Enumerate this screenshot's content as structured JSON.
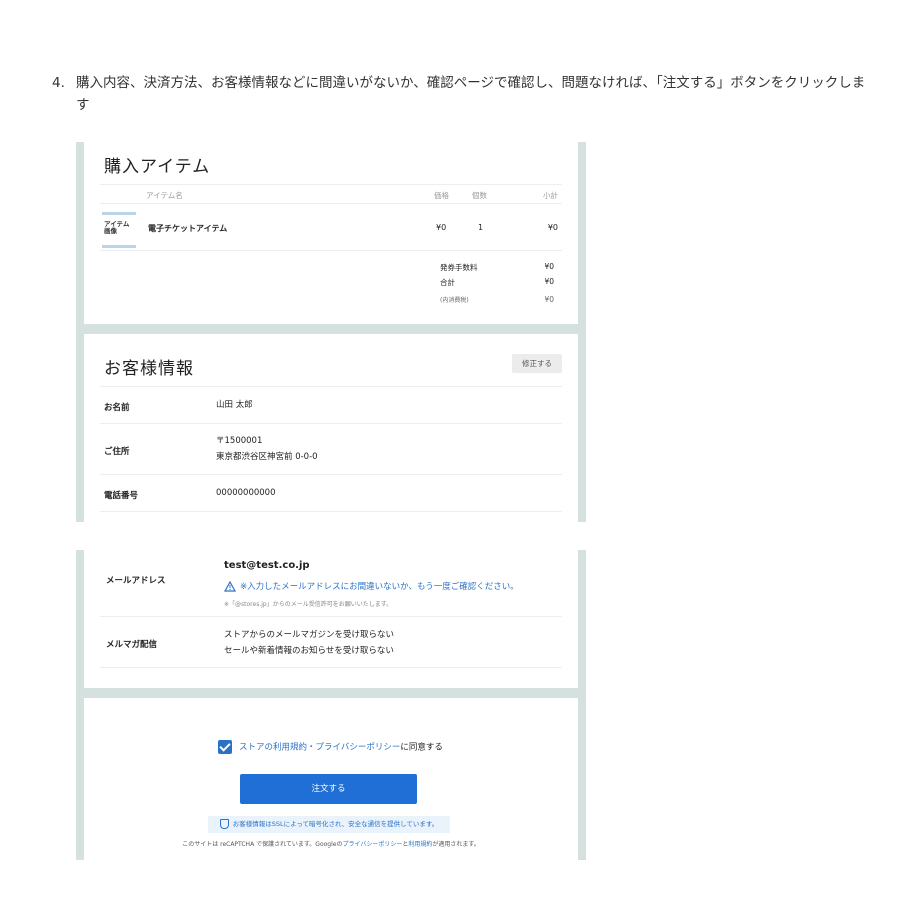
{
  "instruction": {
    "number": "4.",
    "text": "購入内容、決済方法、お客様情報などに間違いがないか、確認ページで確認し、問題なければ、「注文する」ボタンをクリックします"
  },
  "purchase": {
    "title": "購入アイテム",
    "headers": {
      "item": "アイテム名",
      "price": "価格",
      "qty": "個数",
      "subtotal": "小計"
    },
    "item": {
      "image_label": "アイテム\n画像",
      "name": "電子チケットアイテム",
      "price": "¥0",
      "qty": "1",
      "subtotal": "¥0"
    },
    "fee_label": "発券手数料",
    "fee_value": "¥0",
    "total_label": "合計",
    "total_value": "¥0",
    "tax_label": "(内消費税)",
    "tax_value": "¥0"
  },
  "customer": {
    "title": "お客様情報",
    "edit_label": "修正する",
    "name_label": "お名前",
    "name_value": "山田 太郎",
    "address_label": "ご住所",
    "postal": "〒1500001",
    "address": "東京都渋谷区神宮前 0-0-0",
    "phone_label": "電話番号",
    "phone_value": "00000000000"
  },
  "mail": {
    "label": "メールアドレス",
    "email": "test@test.co.jp",
    "warning": "※入力したメールアドレスにお間違いないか、もう一度ご確認ください。",
    "note": "※「@stores.jp」からのメール受信許可をお願いいたします。",
    "magazine_label": "メルマガ配信",
    "magazine_line1": "ストアからのメールマガジンを受け取らない",
    "magazine_line2": "セールや新着情報のお知らせを受け取らない"
  },
  "order": {
    "agree_link": "ストアの利用規約・プライバシーポリシー",
    "agree_suffix": "に同意する",
    "button_label": "注文する",
    "ssl_text": "お客様情報はSSLによって暗号化され、安全な通信を提供しています。",
    "recaptcha_prefix": "このサイトは reCAPTCHA で保護されています。Googleの",
    "privacy_link": "プライバシーポリシー",
    "recaptcha_and": "と",
    "terms_link": "利用規約",
    "recaptcha_suffix": "が適用されます。"
  },
  "colors": {
    "accent": "#2a72c7",
    "button": "#1f6fd6",
    "frame": "#d4e1df"
  }
}
